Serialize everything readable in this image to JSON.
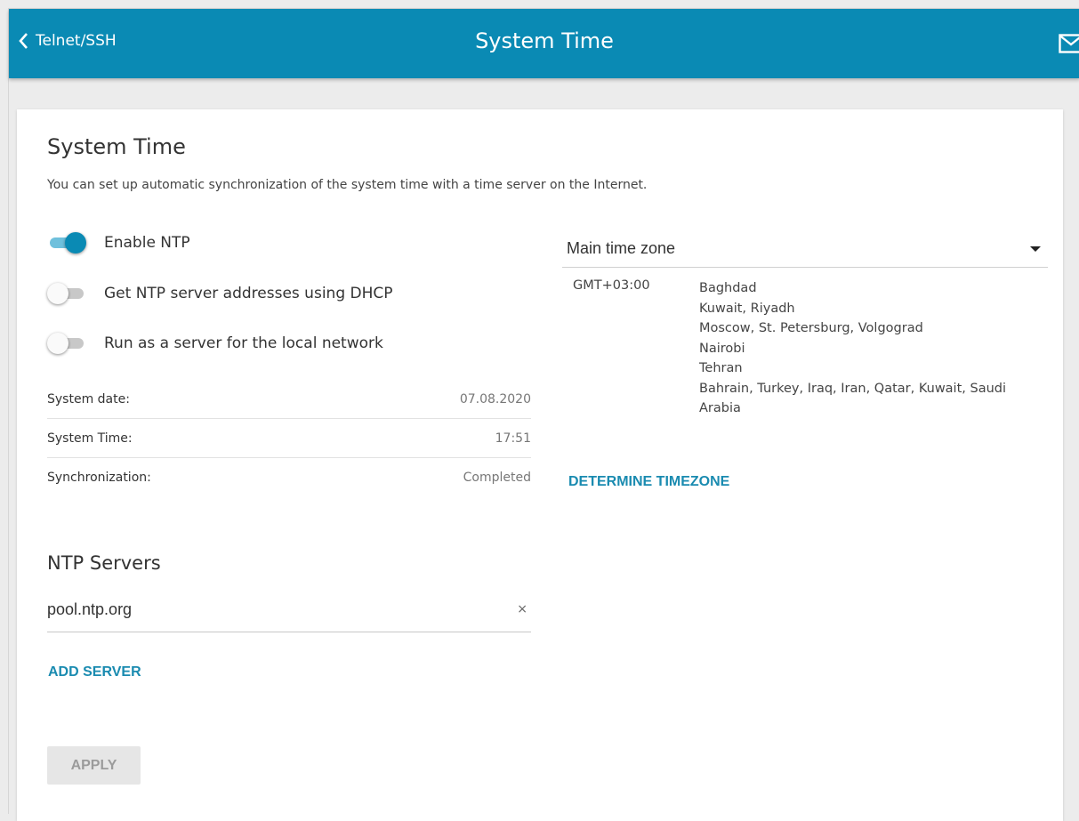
{
  "header": {
    "back_label": "Telnet/SSH",
    "title": "System Time"
  },
  "card": {
    "title": "System Time",
    "description": "You can set up automatic synchronization of the system time with a time server on the Internet."
  },
  "toggles": [
    {
      "label": "Enable NTP",
      "on": true
    },
    {
      "label": "Get NTP server addresses using DHCP",
      "on": false
    },
    {
      "label": "Run as a server for the local network",
      "on": false
    }
  ],
  "info": [
    {
      "label": "System date:",
      "value": "07.08.2020"
    },
    {
      "label": "System Time:",
      "value": "17:51"
    },
    {
      "label": "Synchronization:",
      "value": "Completed"
    }
  ],
  "ntp": {
    "title": "NTP Servers",
    "server": "pool.ntp.org",
    "clear_symbol": "×",
    "add_label": "ADD SERVER"
  },
  "apply_label": "APPLY",
  "timezone": {
    "select_value": "Main time zone",
    "offset": "GMT+03:00",
    "cities": [
      "Baghdad",
      "Kuwait, Riyadh",
      "Moscow, St. Petersburg, Volgograd",
      "Nairobi",
      "Tehran",
      "Bahrain, Turkey, Iraq, Iran, Qatar, Kuwait, Saudi Arabia"
    ],
    "determine_label": "DETERMINE TIMEZONE"
  },
  "colors": {
    "header": "#0a8ab4",
    "accent": "#1a8bb0"
  }
}
